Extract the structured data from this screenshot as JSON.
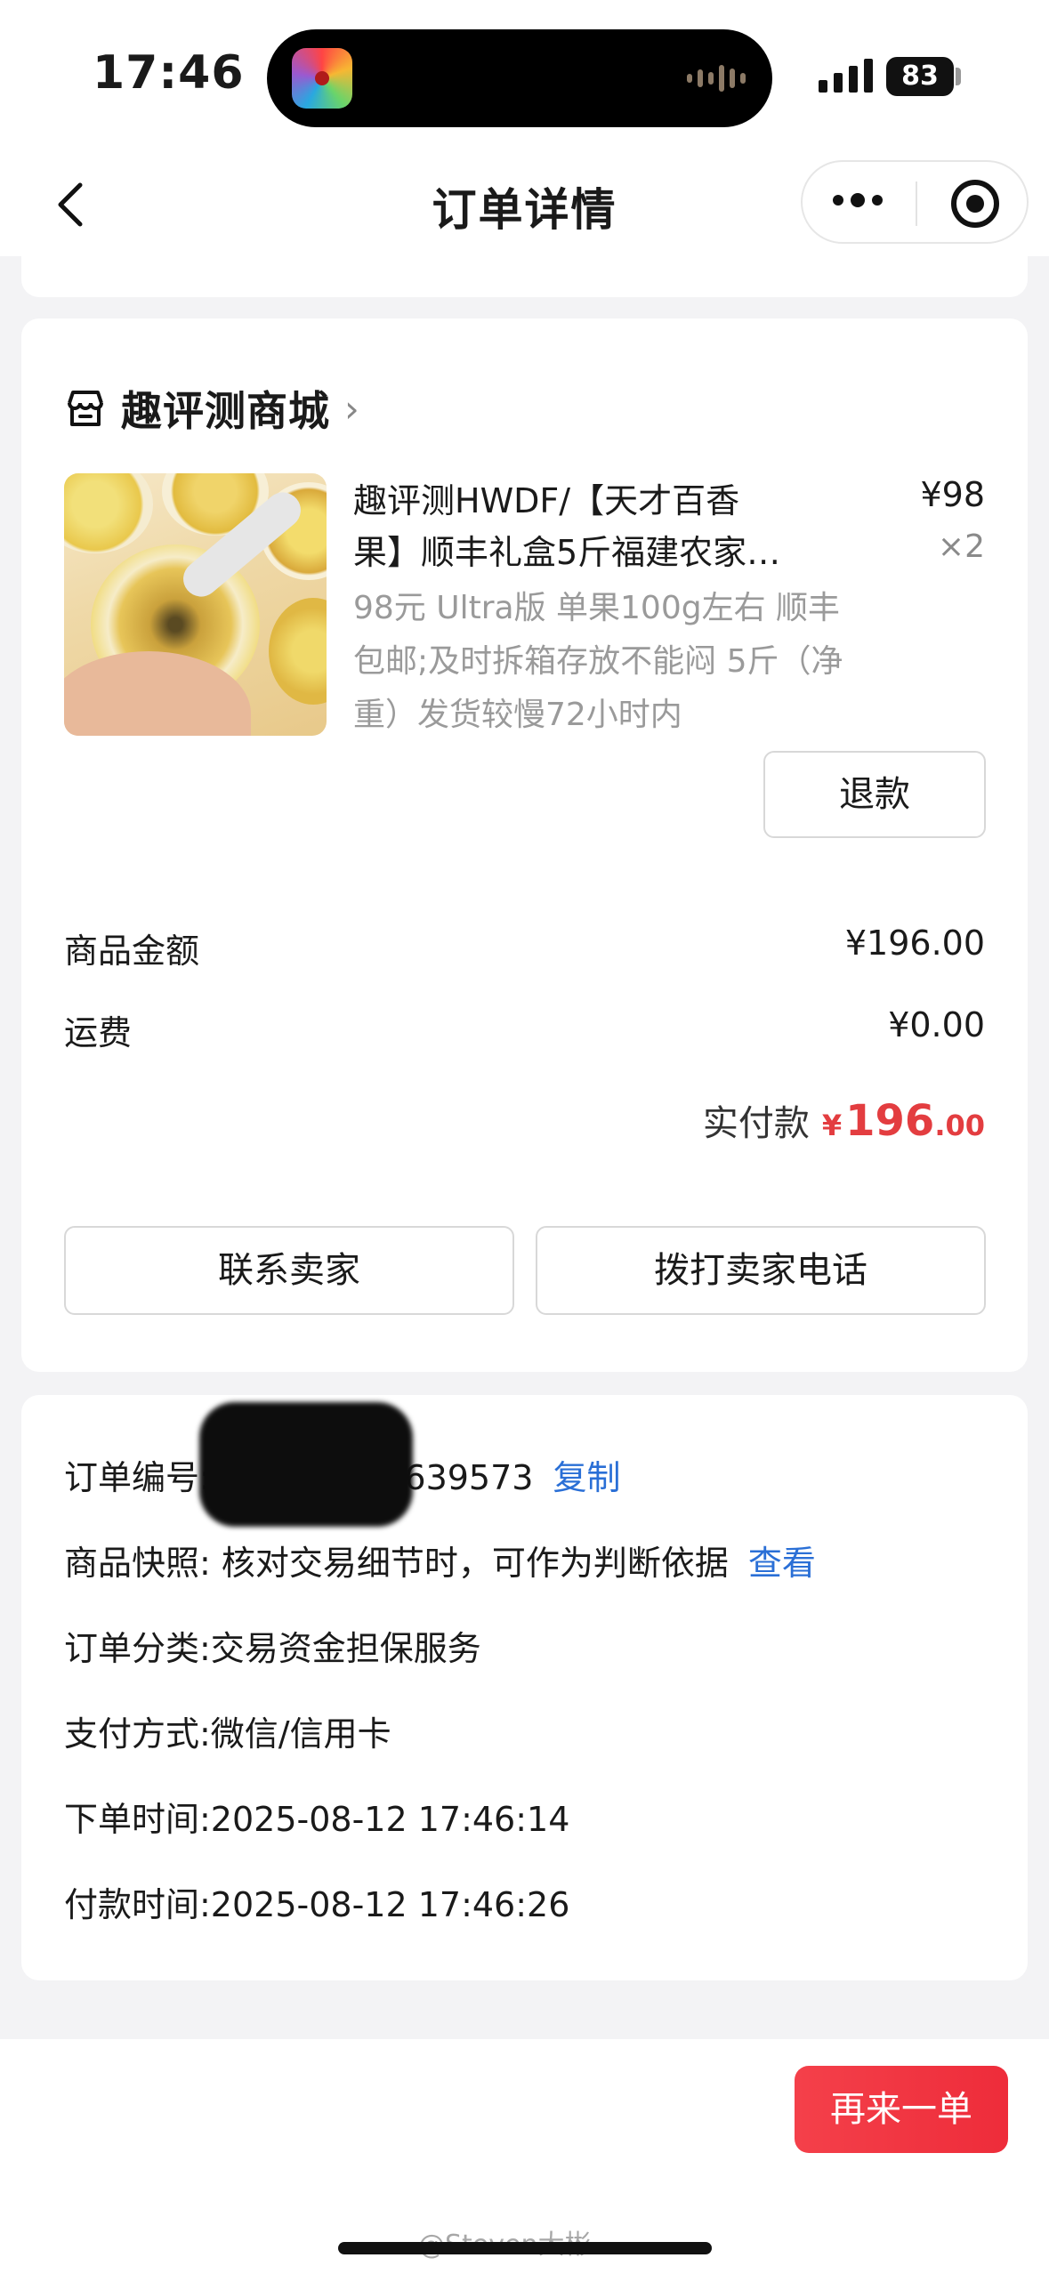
{
  "status_bar": {
    "time": "17:46",
    "battery": "83"
  },
  "nav": {
    "title": "订单详情"
  },
  "shop": {
    "name": "趣评测商城"
  },
  "product": {
    "title_line1": "趣评测HWDF/【天才百香",
    "title_line2": "果】顺丰礼盒5斤福建农家…",
    "spec": "98元 Ultra版 单果100g左右 顺丰包邮;及时拆箱存放不能闷 5斤（净重）发货较慢72小时内",
    "price": "¥98",
    "quantity": "×2",
    "refund_label": "退款"
  },
  "summary": {
    "goods_amount_label": "商品金额",
    "goods_amount_value": "¥196.00",
    "shipping_label": "运费",
    "shipping_value": "¥0.00",
    "paid_label": "实付款",
    "paid_currency": "¥",
    "paid_int": "196",
    "paid_dec": ".00"
  },
  "actions": {
    "contact_seller": "联系卖家",
    "call_seller": "拨打卖家电话"
  },
  "order_info": {
    "order_no_label": "订单编号:",
    "order_no_value": "833475112639573",
    "copy_label": "复制",
    "snapshot_text": "商品快照: 核对交易细节时，可作为判断依据",
    "snapshot_link": "查看",
    "category": "订单分类:交易资金担保服务",
    "payment": "支付方式:微信/信用卡",
    "order_time": "下单时间:2025-08-12 17:46:14",
    "pay_time": "付款时间:2025-08-12 17:46:26"
  },
  "bottom": {
    "reorder_label": "再来一单",
    "watermark": "@Steven大彬"
  },
  "colors": {
    "accent_red": "#e33d40",
    "link_blue": "#2a6fd6",
    "button_red": "#f23a45"
  }
}
